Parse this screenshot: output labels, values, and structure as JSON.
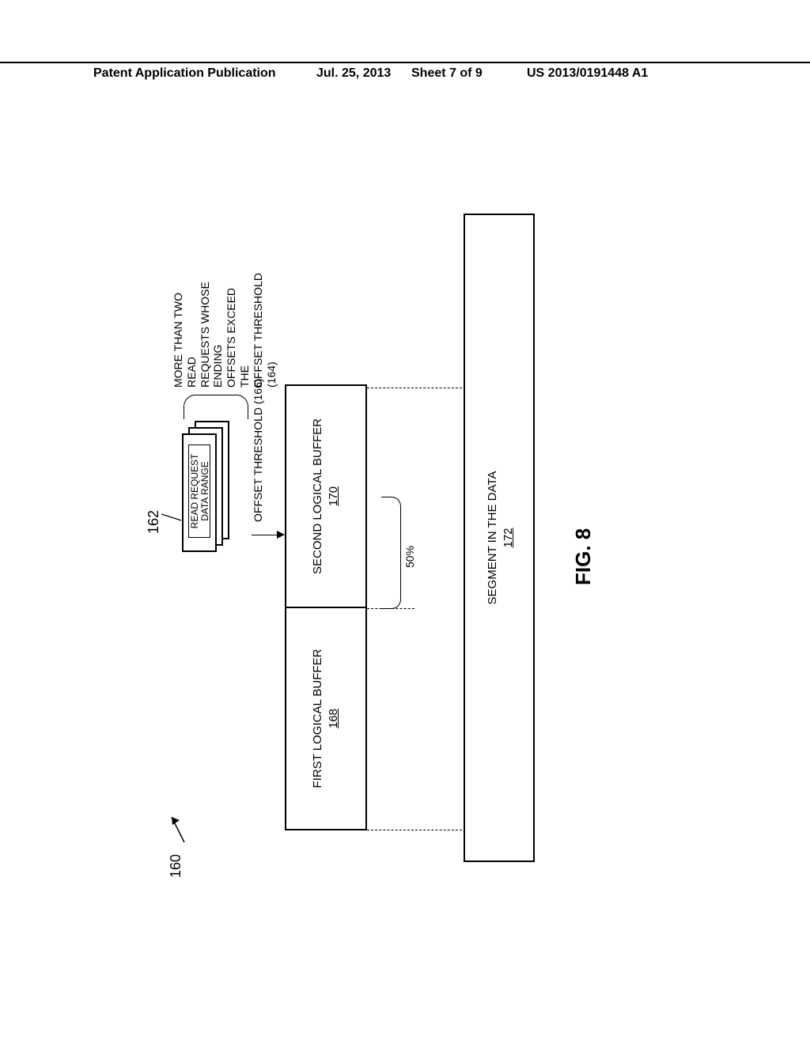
{
  "header": {
    "left": "Patent Application Publication",
    "date": "Jul. 25, 2013",
    "sheet": "Sheet 7 of 9",
    "pubno": "US 2013/0191448 A1"
  },
  "refs": {
    "r160": "160",
    "r162": "162",
    "brace_text_l1": "MORE THAN TWO READ",
    "brace_text_l2": "REQUESTS WHOSE ENDING",
    "brace_text_l3": "OFFSETS EXCEED THE",
    "brace_text_l4": "OFFSET THRESHOLD   (164)"
  },
  "readreq": {
    "line1": "READ REQUEST",
    "line2": "DATA RANGE"
  },
  "offset_label": "OFFSET THRESHOLD (166)",
  "buf1": {
    "label": "FIRST LOGICAL BUFFER",
    "num": "168"
  },
  "buf2": {
    "label": "SECOND LOGICAL BUFFER",
    "num": "170"
  },
  "fifty": "50%",
  "segment": {
    "label": "SEGMENT IN THE DATA",
    "num": "172"
  },
  "figcap": "FIG. 8"
}
